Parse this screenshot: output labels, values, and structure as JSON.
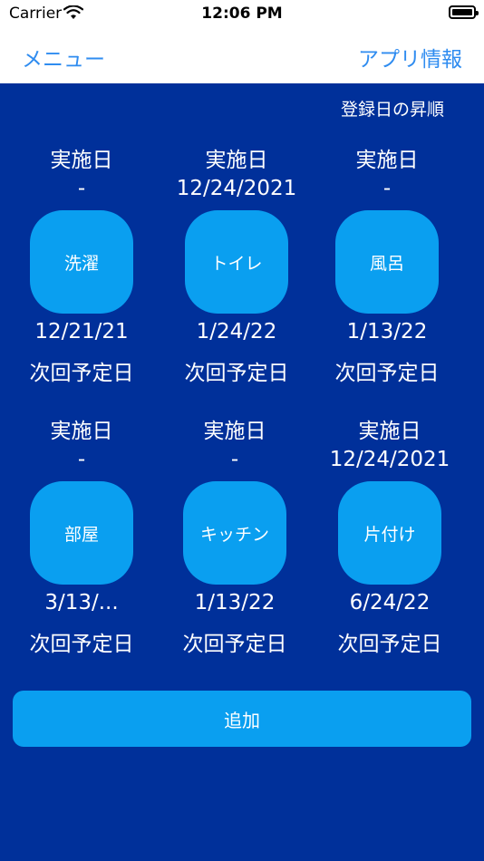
{
  "status_bar": {
    "carrier": "Carrier",
    "time": "12:06 PM"
  },
  "nav": {
    "left": "メニュー",
    "right": "アプリ情報"
  },
  "sort_label": "登録日の昇順",
  "tasks": [
    {
      "done_label": "実施日",
      "done_date": "-",
      "name": "洗濯",
      "next_date": "12/21/21",
      "next_label": "次回予定日"
    },
    {
      "done_label": "実施日",
      "done_date": "12/24/2021",
      "name": "トイレ",
      "next_date": "1/24/22",
      "next_label": "次回予定日"
    },
    {
      "done_label": "実施日",
      "done_date": "-",
      "name": "風呂",
      "next_date": "1/13/22",
      "next_label": "次回予定日"
    },
    {
      "done_label": "実施日",
      "done_date": "-",
      "name": "部屋",
      "next_date": "3/13/...",
      "next_label": "次回予定日"
    },
    {
      "done_label": "実施日",
      "done_date": "-",
      "name": "キッチン",
      "next_date": "1/13/22",
      "next_label": "次回予定日"
    },
    {
      "done_label": "実施日",
      "done_date": "12/24/2021",
      "name": "片付け",
      "next_date": "6/24/22",
      "next_label": "次回予定日"
    }
  ],
  "add_button": "追加",
  "colors": {
    "background": "#00309a",
    "button": "#0a9ff0",
    "nav_text": "#2f8cf0"
  }
}
